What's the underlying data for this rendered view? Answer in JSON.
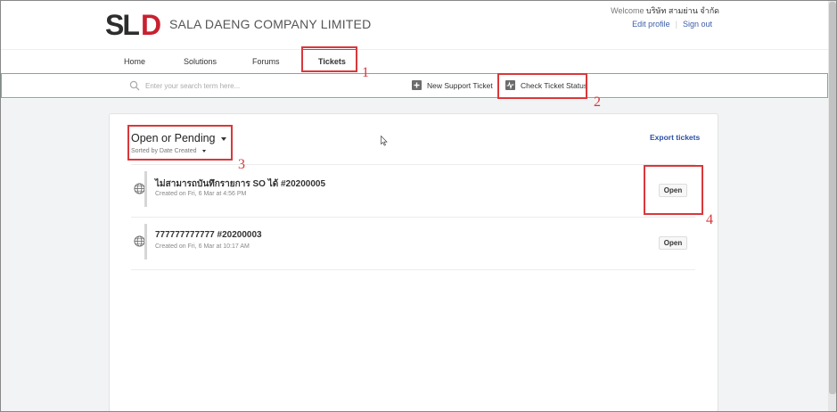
{
  "company": {
    "name": "SALA DAENG COMPANY LIMITED",
    "logo_text": "SLD",
    "colors": {
      "logo_dark": "#2d2d2d",
      "logo_red": "#c8202f"
    }
  },
  "user": {
    "welcome_label": "Welcome",
    "name": "บริษัท สามย่าน จำกัด",
    "edit_profile": "Edit profile",
    "sign_out": "Sign out"
  },
  "nav": {
    "home": "Home",
    "solutions": "Solutions",
    "forums": "Forums",
    "tickets": "Tickets",
    "active": "Tickets"
  },
  "search": {
    "placeholder": "Enter your search term here...",
    "new_ticket": "New Support Ticket",
    "check_status": "Check Ticket Status"
  },
  "tickets_panel": {
    "filter": "Open or Pending",
    "sort": "Sorted by Date Created",
    "export": "Export tickets",
    "items": [
      {
        "title": "ไม่สามารถบันทึกรายการ SO ได้ #20200005",
        "created": "Created on Fri, 6 Mar at 4:56 PM",
        "status": "Open"
      },
      {
        "title": "777777777777 #20200003",
        "created": "Created on Fri, 6 Mar at 10:17 AM",
        "status": "Open"
      }
    ]
  },
  "annotations": [
    "1",
    "2",
    "3",
    "4"
  ],
  "colors": {
    "accent": "#2a8a5e",
    "link": "#2c4fa3",
    "annotation": "#d9383b",
    "search_border": "#5fb89a"
  }
}
